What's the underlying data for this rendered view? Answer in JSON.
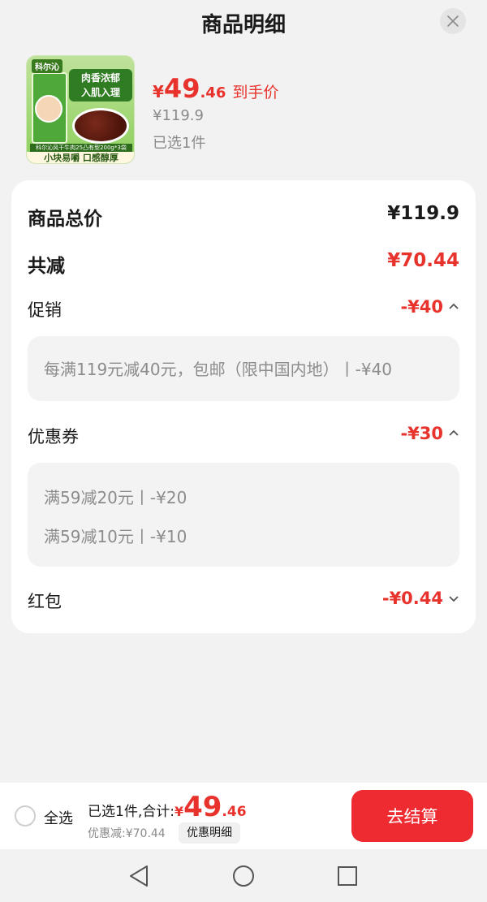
{
  "header": {
    "title": "商品明细",
    "close_icon": "close-icon"
  },
  "product": {
    "image_brand": "科尔沁",
    "image_tag_line1": "肉香浓郁",
    "image_tag_line2": "入肌入理",
    "image_spec": "科尔沁风干牛肉25凸有型200g*3袋",
    "image_slogan": "小块易嚼 口感醇厚",
    "price_yen": "¥",
    "price_int": "49",
    "price_dec": ".46",
    "price_label": "到手价",
    "original_price": "¥119.9",
    "selected_count": "已选1件"
  },
  "summary": {
    "total_label": "商品总价",
    "total_value": "¥119.9",
    "reduce_label": "共减",
    "reduce_value": "¥70.44",
    "promo": {
      "label": "促销",
      "value": "-¥40",
      "items": [
        "每满119元减40元，包邮（限中国内地）丨-¥40"
      ]
    },
    "coupon": {
      "label": "优惠券",
      "value": "-¥30",
      "items": [
        "满59减20元丨-¥20",
        "满59减10元丨-¥10"
      ]
    },
    "redpacket": {
      "label": "红包",
      "value": "-¥0.44"
    }
  },
  "bottom": {
    "select_all": "全选",
    "total_prefix": "已选1件,合计:",
    "total_yen": "¥",
    "total_int": "49",
    "total_dec": ".46",
    "discount_text": "优惠减:¥70.44",
    "detail_button": "优惠明细",
    "checkout_button": "去结算"
  },
  "colors": {
    "accent": "#e8322c",
    "checkout": "#ee2b30",
    "background": "#f2f2f2"
  }
}
